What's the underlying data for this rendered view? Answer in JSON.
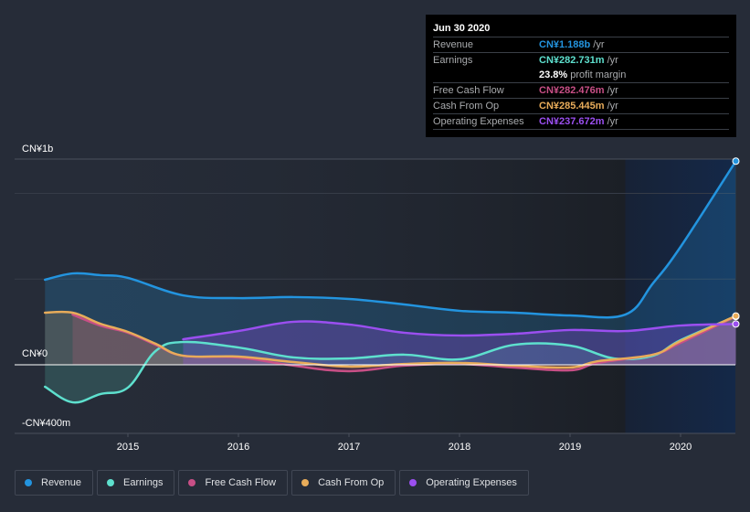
{
  "tooltip": {
    "date": "Jun 30 2020",
    "rows": [
      {
        "label": "Revenue",
        "value": "CN¥1.188b",
        "unit": "/yr",
        "color": "#2394df"
      },
      {
        "label": "Earnings",
        "value": "CN¥282.731m",
        "unit": "/yr",
        "color": "#5ee0ce"
      },
      {
        "label": "",
        "value": "23.8%",
        "unit": "profit margin",
        "color": "#ffffff"
      },
      {
        "label": "Free Cash Flow",
        "value": "CN¥282.476m",
        "unit": "/yr",
        "color": "#c84f86"
      },
      {
        "label": "Cash From Op",
        "value": "CN¥285.445m",
        "unit": "/yr",
        "color": "#e8ac5a"
      },
      {
        "label": "Operating Expenses",
        "value": "CN¥237.672m",
        "unit": "/yr",
        "color": "#9b4ff0"
      }
    ]
  },
  "chart_data": {
    "type": "line",
    "title": "",
    "xlabel": "",
    "ylabel": "",
    "currency": "CN¥",
    "units": "millions",
    "y_tick_labels": [
      {
        "value": 1000,
        "label": "CN¥1b"
      },
      {
        "value": 0,
        "label": "CN¥0"
      },
      {
        "value": -400,
        "label": "-CN¥400m"
      }
    ],
    "x_tick_labels": [
      {
        "value": 2015,
        "label": "2015"
      },
      {
        "value": 2016,
        "label": "2016"
      },
      {
        "value": 2017,
        "label": "2017"
      },
      {
        "value": 2018,
        "label": "2018"
      },
      {
        "value": 2019,
        "label": "2019"
      },
      {
        "value": 2020,
        "label": "2020"
      }
    ],
    "xlim": [
      2013.6,
      2020.5
    ],
    "ylim": [
      -400,
      1200
    ],
    "grid": true,
    "highlight_range": [
      2019.5,
      2020.5
    ],
    "legend_position": "bottom-left",
    "series": [
      {
        "name": "Revenue",
        "color": "#2394df",
        "x": [
          2014.25,
          2014.5,
          2014.75,
          2015.0,
          2015.5,
          2016.0,
          2016.5,
          2017.0,
          2017.5,
          2018.0,
          2018.5,
          2019.0,
          2019.5,
          2019.75,
          2020.0,
          2020.5
        ],
        "values": [
          496,
          533,
          523,
          507,
          405,
          389,
          395,
          384,
          352,
          315,
          304,
          288,
          293,
          475,
          688,
          1188
        ]
      },
      {
        "name": "Earnings",
        "color": "#5ee0ce",
        "x": [
          2014.25,
          2014.5,
          2014.75,
          2015.0,
          2015.25,
          2015.5,
          2016.0,
          2016.5,
          2017.0,
          2017.5,
          2018.0,
          2018.5,
          2019.0,
          2019.4,
          2019.75,
          2020.0,
          2020.5
        ],
        "values": [
          -128,
          -219,
          -171,
          -133,
          80,
          133,
          101,
          43,
          37,
          59,
          32,
          117,
          112,
          37,
          53,
          144,
          283
        ]
      },
      {
        "name": "Free Cash Flow",
        "color": "#c84f86",
        "x": [
          2014.5,
          2014.75,
          2015.0,
          2015.25,
          2015.5,
          2016.0,
          2016.5,
          2017.0,
          2017.5,
          2018.0,
          2018.5,
          2019.0,
          2019.25,
          2019.75,
          2020.0,
          2020.5
        ],
        "values": [
          293,
          229,
          187,
          117,
          53,
          43,
          -5,
          -37,
          -5,
          5,
          -16,
          -32,
          11,
          59,
          128,
          282
        ]
      },
      {
        "name": "Cash From Op",
        "color": "#e8ac5a",
        "x": [
          2014.25,
          2014.5,
          2014.75,
          2015.0,
          2015.25,
          2015.5,
          2016.0,
          2016.5,
          2017.0,
          2017.5,
          2018.0,
          2018.5,
          2019.0,
          2019.25,
          2019.75,
          2020.0,
          2020.5
        ],
        "values": [
          304,
          304,
          240,
          192,
          123,
          53,
          48,
          16,
          -11,
          5,
          11,
          -5,
          -16,
          21,
          59,
          139,
          285
        ]
      },
      {
        "name": "Operating Expenses",
        "color": "#9b4ff0",
        "x": [
          2015.5,
          2016.0,
          2016.5,
          2017.0,
          2017.5,
          2018.0,
          2018.5,
          2019.0,
          2019.5,
          2020.0,
          2020.5
        ],
        "values": [
          149,
          197,
          251,
          235,
          187,
          171,
          181,
          203,
          197,
          229,
          238
        ]
      }
    ]
  },
  "legend": {
    "items": [
      {
        "label": "Revenue",
        "color": "#2394df"
      },
      {
        "label": "Earnings",
        "color": "#5ee0ce"
      },
      {
        "label": "Free Cash Flow",
        "color": "#c84f86"
      },
      {
        "label": "Cash From Op",
        "color": "#e8ac5a"
      },
      {
        "label": "Operating Expenses",
        "color": "#9b4ff0"
      }
    ]
  }
}
